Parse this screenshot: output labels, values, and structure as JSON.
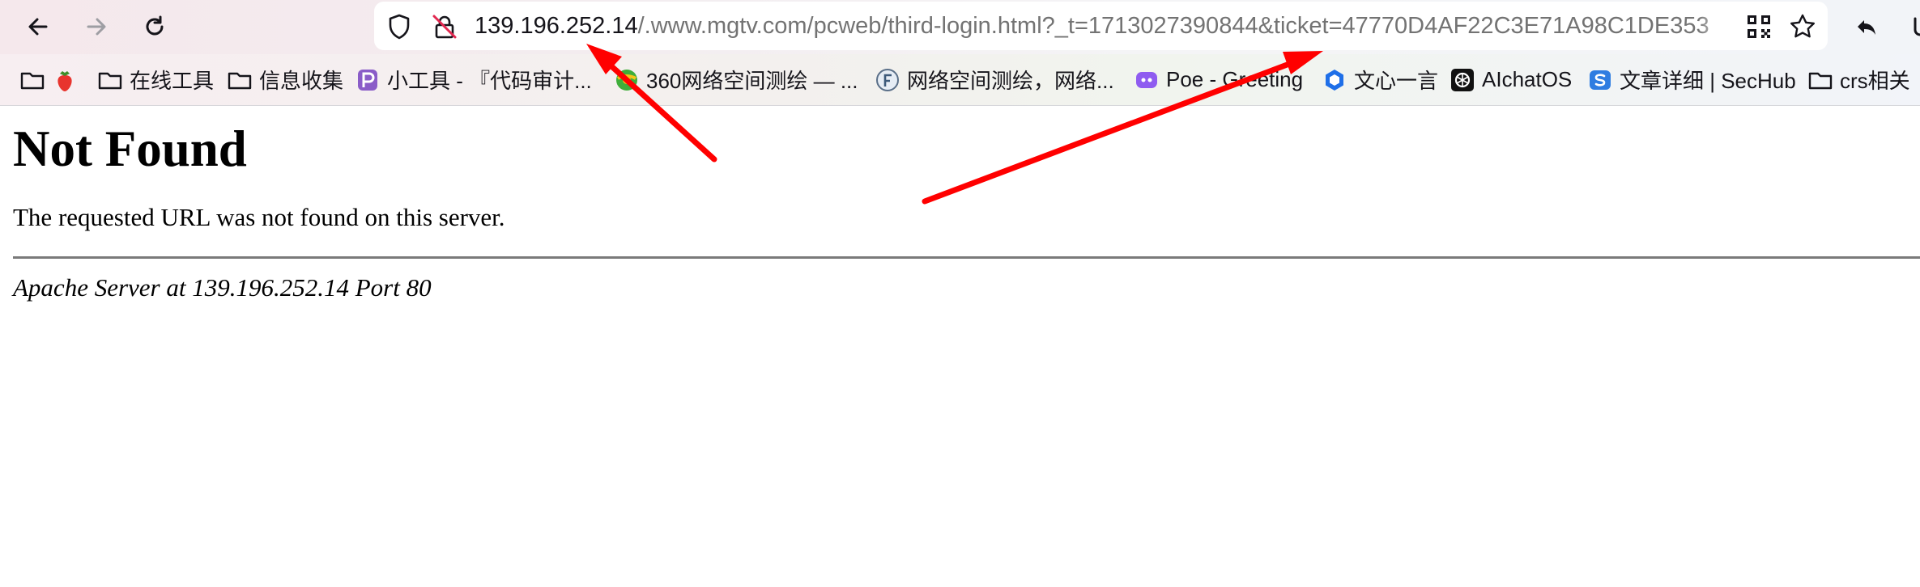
{
  "browser": {
    "url_host": "139.196.252.14",
    "url_rest": "/.www.mgtv.com/pcweb/third-login.html?_t=1713027390844&ticket=47770D4AF22C3E71A98C1DE353",
    "icons": {
      "back": "arrow-left-icon",
      "forward": "arrow-right-icon",
      "reload": "reload-icon",
      "tracking": "shield-icon",
      "insecure": "insecure-lock-icon",
      "qr": "qr-code-icon",
      "bookmark": "star-icon",
      "share": "reply-icon"
    }
  },
  "bookmarks": [
    {
      "label": "",
      "icon": "folder-icon"
    },
    {
      "label": "在线工具",
      "icon": "folder-icon"
    },
    {
      "label": "信息收集",
      "icon": "folder-icon"
    },
    {
      "label": "小工具 - 『代码审计...",
      "icon": "purple-p-icon"
    },
    {
      "label": "360网络空间测绘 — ...",
      "icon": "globe-360-icon"
    },
    {
      "label": "网络空间测绘，网络...",
      "icon": "fofa-icon"
    },
    {
      "label": "Poe - Greeting",
      "icon": "poe-icon"
    },
    {
      "label": "文心一言",
      "icon": "wenxin-icon"
    },
    {
      "label": "AIchatOS",
      "icon": "openai-icon"
    },
    {
      "label": "文章详细 | SecHub",
      "icon": "sechub-icon"
    },
    {
      "label": "crs相关",
      "icon": "folder-icon"
    }
  ],
  "page": {
    "heading": "Not Found",
    "message": "The requested URL was not found on this server.",
    "footer": "Apache Server at 139.196.252.14 Port 80"
  },
  "annotations": {
    "arrow_color": "#ff0000"
  }
}
